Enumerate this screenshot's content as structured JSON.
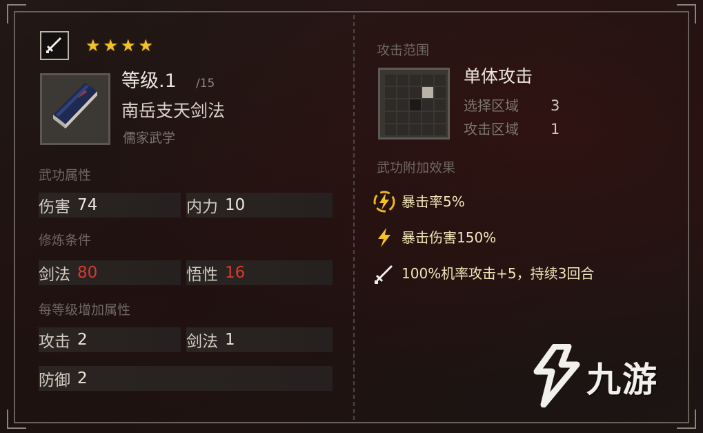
{
  "skill": {
    "stars": [
      "★",
      "★",
      "★",
      "★"
    ],
    "level_label": "等级.1",
    "level_max": "/15",
    "name": "南岳支天剑法",
    "school": "儒家武学"
  },
  "sections": {
    "attributes": "武功属性",
    "requirements": "修炼条件",
    "per_level": "每等级增加属性"
  },
  "attributes": [
    {
      "label": "伤害",
      "value": "74"
    },
    {
      "label": "内力",
      "value": "10"
    }
  ],
  "requirements": [
    {
      "label": "剑法",
      "value": "80"
    },
    {
      "label": "悟性",
      "value": "16"
    }
  ],
  "per_level": [
    {
      "label": "攻击",
      "value": "2"
    },
    {
      "label": "剑法",
      "value": "1"
    },
    {
      "label": "防御",
      "value": "2"
    }
  ],
  "range": {
    "title": "攻击范围",
    "type": "单体攻击",
    "select_label": "选择区域",
    "select_value": "3",
    "attack_label": "攻击区域",
    "attack_value": "1"
  },
  "effects": {
    "title": "武功附加效果",
    "items": [
      {
        "icon": "lightning-circle-icon",
        "text": "暴击率5%"
      },
      {
        "icon": "lightning-icon",
        "text": "暴击伤害150%"
      },
      {
        "icon": "sword-icon",
        "text": "100%机率攻击+5，持续3回合"
      }
    ]
  },
  "watermark": "九游",
  "colors": {
    "star": "#f2c22a",
    "requirement_value": "#d63a2e",
    "effect_text": "#efe6b8"
  }
}
